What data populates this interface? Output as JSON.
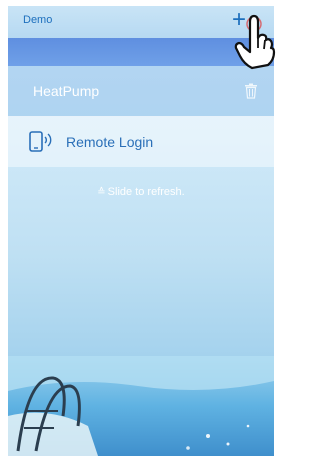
{
  "header": {
    "title": "Demo",
    "add_icon": "plus-icon"
  },
  "devices": [
    {
      "name": "HeatPump",
      "delete_icon": "trash-icon"
    }
  ],
  "remote_login": {
    "label": "Remote Login",
    "icon": "phone-wireless-icon"
  },
  "refresh_hint": "Slide to refresh.",
  "colors": {
    "accent": "#1d6fbd",
    "band": "#5f8fe0"
  }
}
